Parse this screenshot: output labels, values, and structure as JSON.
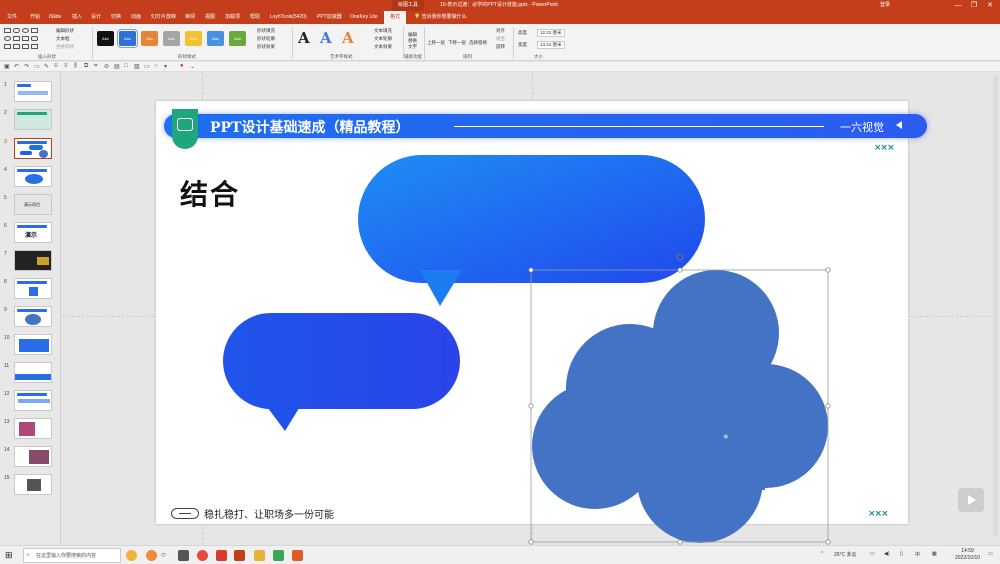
{
  "window": {
    "contextual_tab": "绘图工具",
    "doc_title": "10-表示过渡：必学的PPT设计技能.pptx  -  PowerPoint",
    "user": "登录",
    "minimize": "—",
    "restore": "❐",
    "close": "✕"
  },
  "tabs": [
    "文件",
    "开始",
    "iSlide",
    "插入",
    "设计",
    "切换",
    "动画",
    "幻灯片放映",
    "审阅",
    "视图",
    "加载项",
    "帮助",
    "LvyhTools(5420)",
    "PPT加速器",
    "OneKey Lite",
    "格式"
  ],
  "tell_me": "告诉我你想要做什么",
  "ribbon": {
    "insert_shapes": {
      "label": "插入形状",
      "edit_shape": "编辑形状",
      "text_box": "文本框",
      "merge_shapes": "合并形状"
    },
    "shape_styles": {
      "label": "形状样式",
      "swatch_text": "Abc",
      "swatches": [
        "#111111",
        "#2e6fd8",
        "#e8833a",
        "#a5a5a5",
        "#f2c12e",
        "#4a90e2",
        "#6aaa3c"
      ],
      "fill": "形状填充",
      "outline": "形状轮廓",
      "effects": "形状效果"
    },
    "wordart_styles": {
      "label": "艺术字样式",
      "letter": "A",
      "text_fill": "文本填充",
      "text_outline": "文本轮廓",
      "text_effects": "文本效果"
    },
    "accessibility": {
      "label": "辅助功能",
      "alt_text": "编辑替换文字"
    },
    "arrange": {
      "label": "排列",
      "bring_forward": "上移一层",
      "send_backward": "下移一层",
      "selection_pane": "选择窗格",
      "align": "对齐",
      "group": "组合",
      "rotate": "旋转"
    },
    "size": {
      "label": "大小",
      "height_label": "高度",
      "height": "12.22 厘米",
      "width_label": "宽度",
      "width": "13.34 厘米"
    }
  },
  "thumbnails": [
    "1",
    "2",
    "3",
    "4",
    "5",
    "6",
    "7",
    "8",
    "9",
    "10",
    "11",
    "12",
    "13",
    "14",
    "15"
  ],
  "thumbnail_texts": {
    "5": "演示项目",
    "6": "演示"
  },
  "slide": {
    "banner_title": "PPT设计基础速成（精品教程）",
    "banner_brand": "一六视觉",
    "heading": "结合",
    "xmark": "×××",
    "footer_text": "稳扎稳打、让职场多一份可能"
  },
  "taskbar": {
    "search_placeholder": "在这里输入你要搜索的内容",
    "weather": "26°C  多云",
    "lang": "中",
    "time": "14:59",
    "date": "2022/10/10"
  },
  "colors": {
    "accent": "#c43e1c",
    "bubble_blue": "#1f5cf0",
    "cloud_blue": "#4472c4",
    "banner_blue": "#2466ef",
    "logo_green": "#20a67c"
  }
}
